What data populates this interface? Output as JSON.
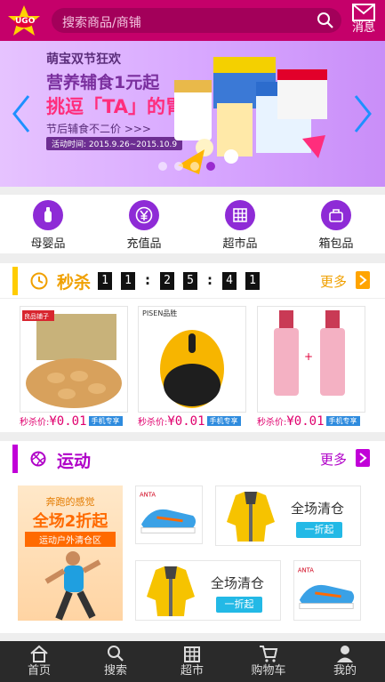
{
  "header": {
    "logo_text": "UGO",
    "search_placeholder": "搜索商品/商铺",
    "message_label": "消息"
  },
  "banner": {
    "line1": "萌宝双节狂欢",
    "line2": "营养辅食1元起",
    "line3": "挑逗「TA」的胃",
    "line4": "节后辅食不二价 >>>",
    "line5": "活动时间: 2015.9.26~2015.10.9",
    "slide_count": 4,
    "active_slide": 3
  },
  "categories": [
    {
      "label": "母婴品",
      "icon": "baby-bottle-icon"
    },
    {
      "label": "充值品",
      "icon": "yen-icon"
    },
    {
      "label": "超市品",
      "icon": "store-icon"
    },
    {
      "label": "箱包品",
      "icon": "bag-icon"
    }
  ],
  "flash_sale": {
    "title": "秒杀",
    "digits": [
      "1",
      "1",
      "2",
      "5",
      "4",
      "1"
    ],
    "more": "更多",
    "products": [
      {
        "name": "nuts",
        "brand": "良品铺子",
        "price_label": "秒杀价:",
        "price": "¥0.01",
        "share": "手机专享"
      },
      {
        "name": "mouse",
        "brand": "PISEN品胜",
        "price_label": "秒杀价:",
        "price": "¥0.01",
        "share": "手机专享"
      },
      {
        "name": "cosmetics",
        "brand": "",
        "price_label": "秒杀价:",
        "price": "¥0.01",
        "share": "手机专享"
      }
    ]
  },
  "sports": {
    "title": "运动",
    "more": "更多",
    "promo_line1": "奔跑的感觉",
    "promo_line2": "全场2折起",
    "promo_line3": "运动户外清仓区",
    "tile_text": "全场清仓",
    "tile_button": "一折起",
    "tile_text_2": "全场清仓",
    "tile_button_2": "一折起"
  },
  "tabbar": [
    {
      "label": "首页",
      "icon": "home-icon"
    },
    {
      "label": "搜索",
      "icon": "search-icon"
    },
    {
      "label": "超市",
      "icon": "store-icon"
    },
    {
      "label": "购物车",
      "icon": "cart-icon"
    },
    {
      "label": "我的",
      "icon": "user-icon"
    }
  ],
  "colors": {
    "brand": "#c5006a",
    "accent_purple": "#8e2bd6",
    "flash_yellow": "#f0a000",
    "sport_purple": "#b000c8"
  }
}
